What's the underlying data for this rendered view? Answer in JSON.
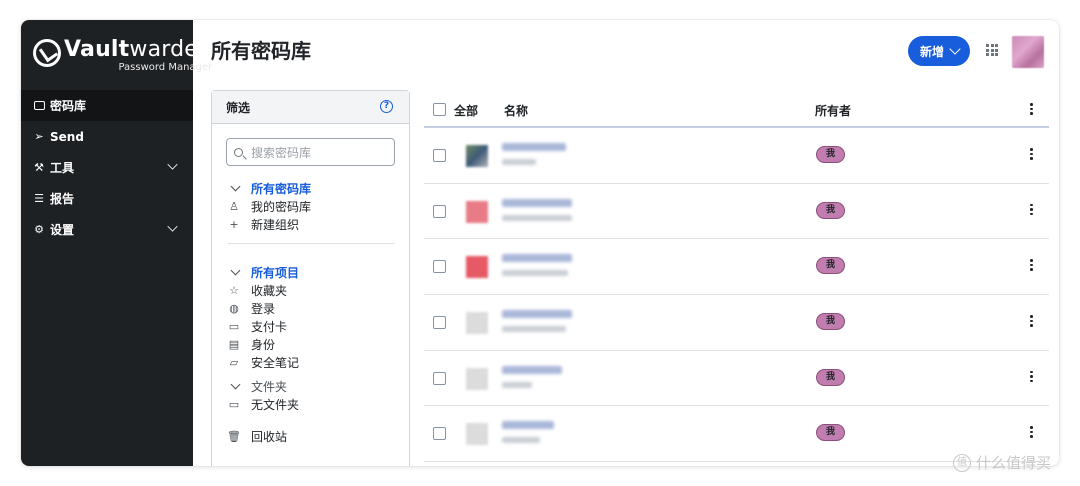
{
  "app": {
    "logo_bold": "Vault",
    "logo_rest": "warden",
    "logo_sub": "Password Manager"
  },
  "sidebar": {
    "items": [
      {
        "label": "密码库",
        "icon": "vault-icon",
        "active": true,
        "expandable": false
      },
      {
        "label": "Send",
        "icon": "send-icon",
        "active": false,
        "expandable": false
      },
      {
        "label": "工具",
        "icon": "wrench-icon",
        "active": false,
        "expandable": true
      },
      {
        "label": "报告",
        "icon": "sliders-icon",
        "active": false,
        "expandable": false
      },
      {
        "label": "设置",
        "icon": "gear-icon",
        "active": false,
        "expandable": true
      }
    ]
  },
  "header": {
    "title": "所有密码库",
    "new_button": "新增"
  },
  "filter": {
    "title": "筛选",
    "search_placeholder": "搜索密码库",
    "vaults_group": "所有密码库",
    "vault_items": [
      {
        "label": "我的密码库",
        "icon": "user-icon"
      },
      {
        "label": "新建组织",
        "icon": "plus-icon"
      }
    ],
    "items_group": "所有项目",
    "type_items": [
      {
        "label": "收藏夹",
        "icon": "star-icon"
      },
      {
        "label": "登录",
        "icon": "globe-icon"
      },
      {
        "label": "支付卡",
        "icon": "credit-card-icon"
      },
      {
        "label": "身份",
        "icon": "id-card-icon"
      },
      {
        "label": "安全笔记",
        "icon": "note-icon"
      }
    ],
    "folders_group": "文件夹",
    "folder_items": [
      {
        "label": "无文件夹",
        "icon": "folder-icon"
      }
    ],
    "trash": "回收站"
  },
  "table": {
    "col_all": "全部",
    "col_name": "名称",
    "col_owner": "所有者",
    "rows": [
      {
        "owner": "我"
      },
      {
        "owner": "我"
      },
      {
        "owner": "我"
      },
      {
        "owner": "我"
      },
      {
        "owner": "我"
      },
      {
        "owner": "我"
      }
    ]
  },
  "colors": {
    "sidebar_bg": "#1e2124",
    "accent": "#175ddc",
    "owner_badge": "#c27db0"
  },
  "watermark": "什么值得买"
}
